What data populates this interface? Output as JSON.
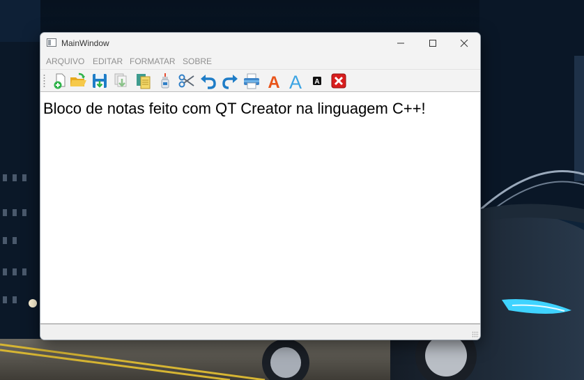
{
  "window": {
    "title": "MainWindow",
    "controls": [
      "minimize-icon",
      "maximize-icon",
      "close-icon"
    ]
  },
  "menubar": {
    "items": [
      {
        "label": "ARQUIVO"
      },
      {
        "label": "EDITAR"
      },
      {
        "label": "FORMATAR"
      },
      {
        "label": "SOBRE"
      }
    ]
  },
  "toolbar": {
    "tools": [
      {
        "icon": "new-file-icon"
      },
      {
        "icon": "open-folder-icon"
      },
      {
        "icon": "save-icon"
      },
      {
        "icon": "save-as-icon"
      },
      {
        "icon": "copy-icon"
      },
      {
        "icon": "paste-glue-icon"
      },
      {
        "icon": "scissors-icon"
      },
      {
        "icon": "undo-icon"
      },
      {
        "icon": "redo-icon"
      },
      {
        "icon": "printer-icon"
      },
      {
        "icon": "font-color-icon",
        "glyph": "A",
        "color": "#e8541a"
      },
      {
        "icon": "font-icon",
        "glyph": "A",
        "color": "#3aa3e3"
      },
      {
        "icon": "font-background-icon",
        "glyph": "A"
      },
      {
        "icon": "exit-icon"
      }
    ]
  },
  "editor": {
    "text": "Bloco de notas feito com QT Creator na linguagem C++!"
  },
  "colors": {
    "window_bg": "#f0f0f0",
    "editor_bg": "#ffffff",
    "menu_text": "#8f8f8f",
    "exit_red": "#d81e1e"
  }
}
